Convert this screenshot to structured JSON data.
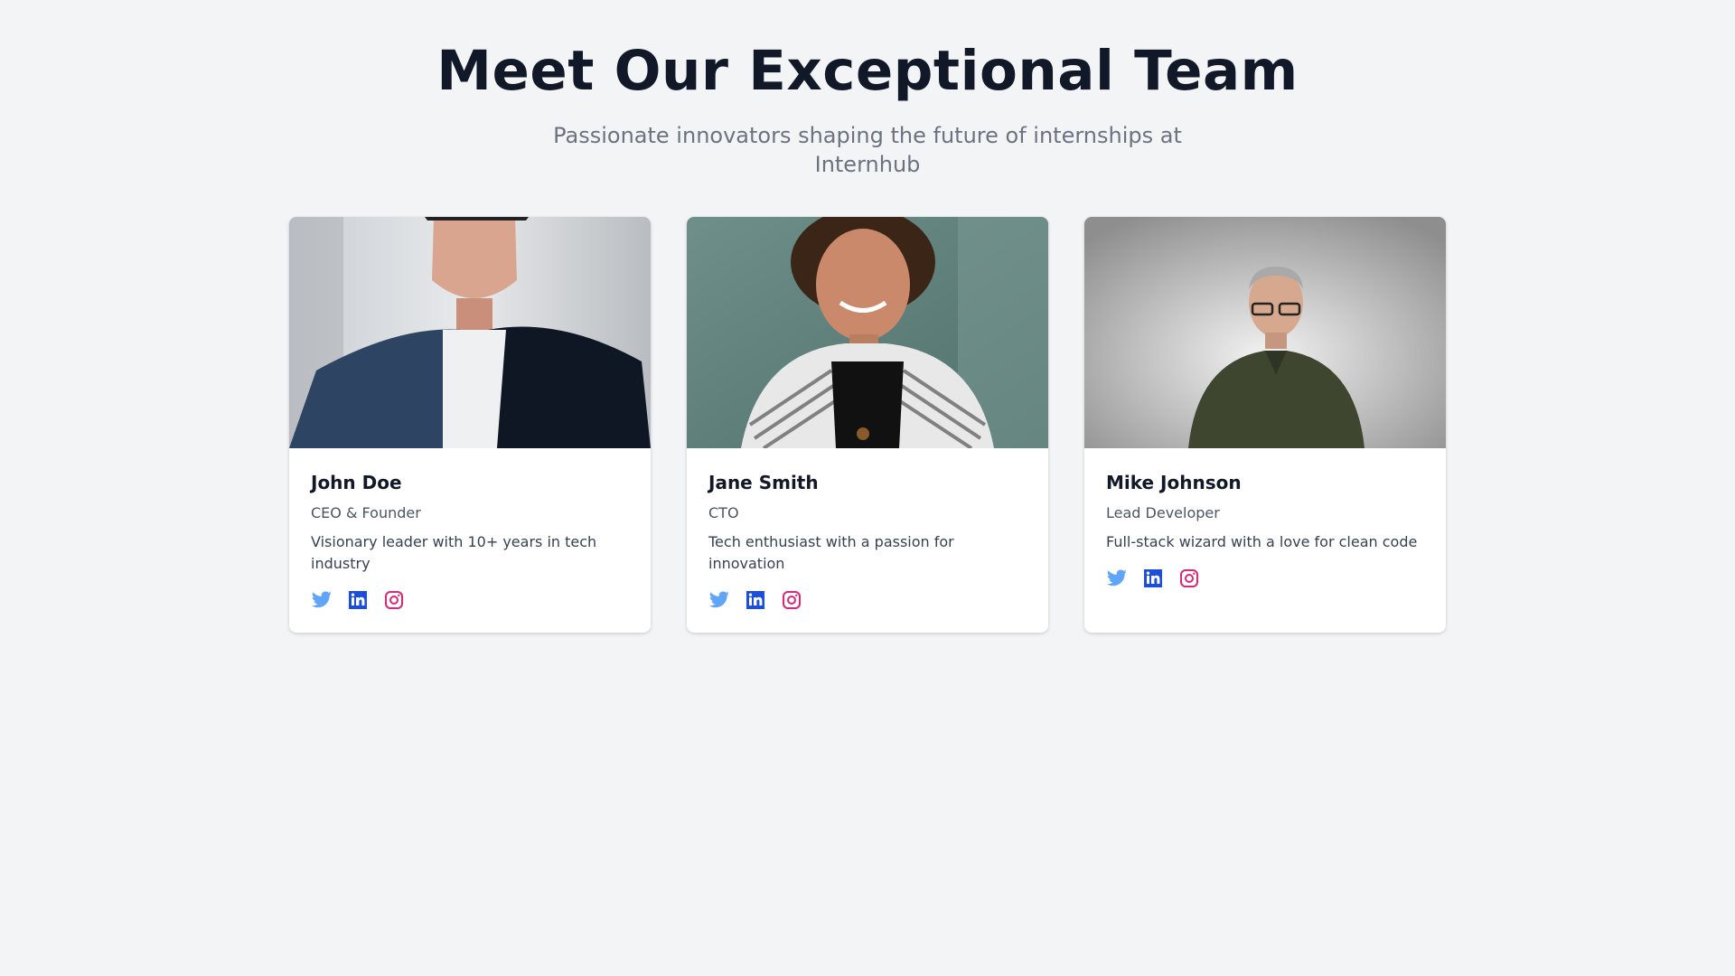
{
  "header": {
    "title": "Meet Our Exceptional Team",
    "subtitle": "Passionate innovators shaping the future of internships at Internhub"
  },
  "colors": {
    "twitter": "#60a5fa",
    "linkedin": "#1d4ed8",
    "instagram": "#db2777",
    "page_bg": "#f3f4f6",
    "title": "#111827"
  },
  "team": [
    {
      "name": "John Doe",
      "role": "CEO & Founder",
      "description": "Visionary leader with 10+ years in tech industry",
      "socials": [
        "twitter-icon",
        "linkedin-icon",
        "instagram-icon"
      ]
    },
    {
      "name": "Jane Smith",
      "role": "CTO",
      "description": "Tech enthusiast with a passion for innovation",
      "socials": [
        "twitter-icon",
        "linkedin-icon",
        "instagram-icon"
      ]
    },
    {
      "name": "Mike Johnson",
      "role": "Lead Developer",
      "description": "Full-stack wizard with a love for clean code",
      "socials": [
        "twitter-icon",
        "linkedin-icon",
        "instagram-icon"
      ]
    }
  ]
}
